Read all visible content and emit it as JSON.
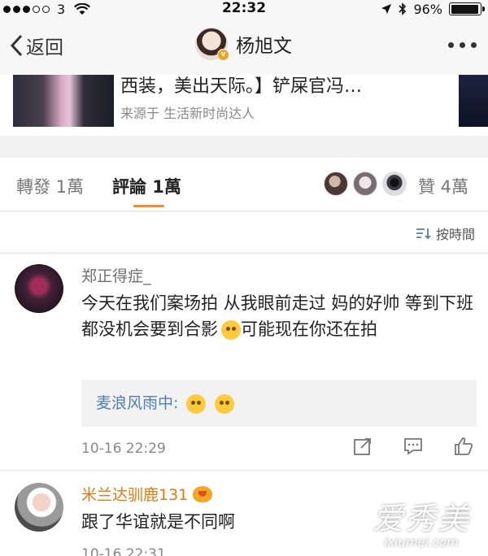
{
  "status_bar": {
    "carrier": "3",
    "time": "22:32",
    "battery": "96%",
    "battery_level": 0.96
  },
  "nav": {
    "back_label": "返回",
    "title": "杨旭文",
    "verified_badge": "v"
  },
  "article": {
    "title": "西装，美出天际。】铲屎官冯…",
    "source": "来源于 生活新时尚达人"
  },
  "tabs": {
    "repost": "轉發 1萬",
    "comment": "評論 1萬",
    "likes": "贊 4萬"
  },
  "sort": {
    "label": "按時間"
  },
  "comments": [
    {
      "name": "郑正得症_",
      "text": "今天在我们案场拍 从我眼前走过 妈的好帅 等到下班都没机会要到合影",
      "text_after_emoji": "可能现在你还在拍",
      "reply": {
        "name": "麦浪风雨中",
        "colon": ":"
      },
      "time": "10-16 22:29",
      "icons": [
        "share-icon",
        "comment-icon",
        "like-icon"
      ]
    },
    {
      "name": "米兰达驯鹿131",
      "text": "跟了华谊就是不同啊",
      "time": "10-16 22:31"
    }
  ],
  "watermark": {
    "main": "爱秀美",
    "sub": "ixiumei.com"
  },
  "colors": {
    "accent": "#f38b26",
    "link": "#4e7fb4",
    "vip_name": "#e07b0b"
  }
}
